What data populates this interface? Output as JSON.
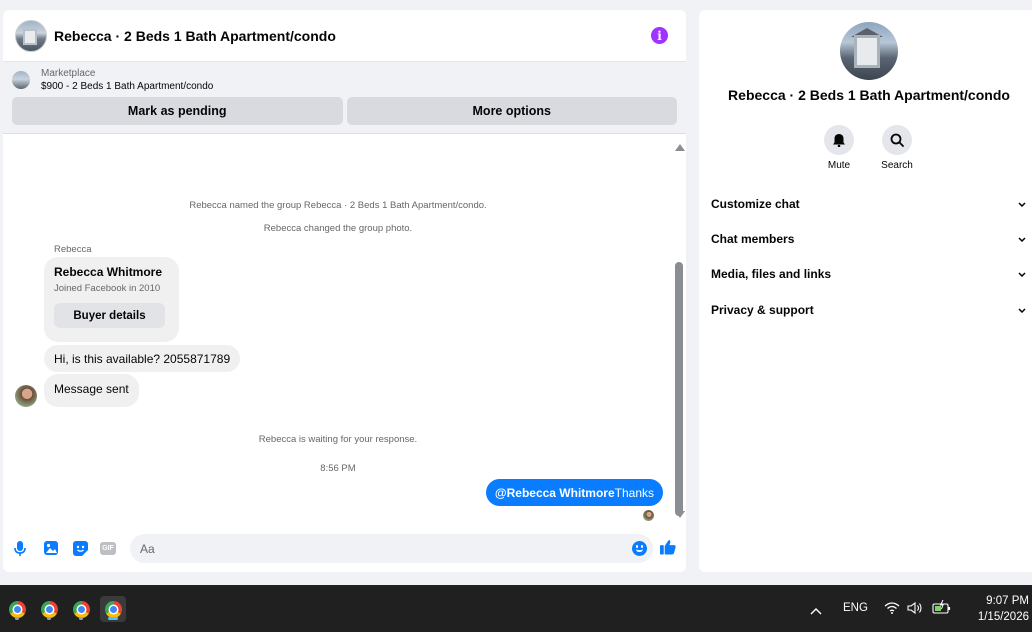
{
  "chat": {
    "title": "Rebecca · 2 Beds 1 Bath Apartment/condo",
    "info_icon": "info-icon",
    "marketplace": {
      "label": "Marketplace",
      "item": "$900 - 2 Beds 1 Bath Apartment/condo",
      "buttons": [
        "Mark as pending",
        "More options"
      ]
    },
    "system_messages": [
      "Rebecca named the group Rebecca · 2 Beds 1 Bath Apartment/condo.",
      "Rebecca changed the group photo.",
      "Rebecca is waiting for your response."
    ],
    "sender_label": "Rebecca",
    "card": {
      "name": "Rebecca Whitmore",
      "subtitle": "Joined Facebook in 2010",
      "button": "Buyer details"
    },
    "incoming": [
      "Hi, is this available? 2055871789",
      "Message sent"
    ],
    "timestamp": "8:56 PM",
    "outgoing": {
      "mention": "@Rebecca Whitmore",
      "text": "Thanks"
    },
    "composer": {
      "placeholder": "Aa",
      "gif_label": "GIF"
    },
    "colors": {
      "accent": "#0a7cff",
      "info": "#a033ff"
    }
  },
  "info_panel": {
    "title": "Rebecca · 2 Beds 1 Bath Apartment/condo",
    "actions": [
      {
        "label": "Mute",
        "icon": "bell-icon"
      },
      {
        "label": "Search",
        "icon": "search-icon"
      }
    ],
    "sections": [
      "Customize chat",
      "Chat members",
      "Media, files and links",
      "Privacy & support"
    ]
  },
  "taskbar": {
    "language": "ENG",
    "time": "9:07 PM",
    "date": "1/15/2026"
  }
}
